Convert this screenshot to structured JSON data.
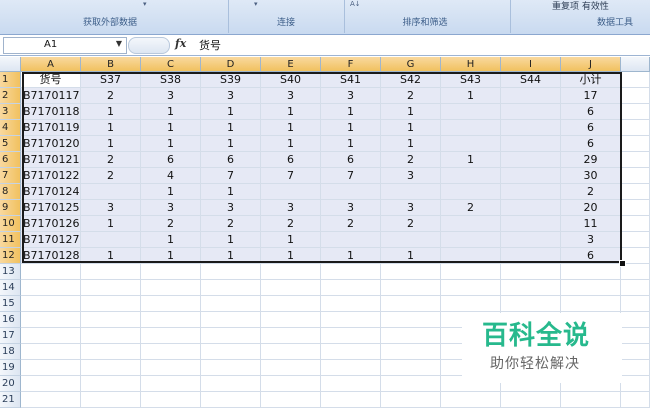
{
  "ribbon": {
    "groups": [
      {
        "label": "获取外部数据"
      },
      {
        "label": "连接"
      },
      {
        "label": "排序和筛选"
      },
      {
        "label": "数据工具"
      }
    ],
    "upper_text": "重复项 有效性"
  },
  "formula_bar": {
    "name_box": "A1",
    "fx_label": "fx",
    "content": "货号"
  },
  "columns": [
    "A",
    "B",
    "C",
    "D",
    "E",
    "F",
    "G",
    "H",
    "I",
    "J"
  ],
  "row_numbers": [
    "1",
    "2",
    "3",
    "4",
    "5",
    "6",
    "7",
    "8",
    "9",
    "10",
    "11",
    "12",
    "13",
    "14",
    "15",
    "16",
    "17",
    "18",
    "19",
    "20",
    "21"
  ],
  "table": {
    "header": [
      "货号",
      "S37",
      "S38",
      "S39",
      "S40",
      "S41",
      "S42",
      "S43",
      "S44",
      "小计"
    ],
    "rows": [
      [
        "B7170117",
        "2",
        "3",
        "3",
        "3",
        "3",
        "2",
        "1",
        "",
        "17"
      ],
      [
        "B7170118",
        "1",
        "1",
        "1",
        "1",
        "1",
        "1",
        "",
        "",
        "6"
      ],
      [
        "B7170119",
        "1",
        "1",
        "1",
        "1",
        "1",
        "1",
        "",
        "",
        "6"
      ],
      [
        "B7170120",
        "1",
        "1",
        "1",
        "1",
        "1",
        "1",
        "",
        "",
        "6"
      ],
      [
        "B7170121",
        "2",
        "6",
        "6",
        "6",
        "6",
        "2",
        "1",
        "",
        "29"
      ],
      [
        "B7170122",
        "2",
        "4",
        "7",
        "7",
        "7",
        "3",
        "",
        "",
        "30"
      ],
      [
        "B7170124",
        "",
        "1",
        "1",
        "",
        "",
        "",
        "",
        "",
        "2"
      ],
      [
        "B7170125",
        "3",
        "3",
        "3",
        "3",
        "3",
        "3",
        "2",
        "",
        "20"
      ],
      [
        "B7170126",
        "1",
        "2",
        "2",
        "2",
        "2",
        "2",
        "",
        "",
        "11"
      ],
      [
        "B7170127",
        "",
        "1",
        "1",
        "1",
        "",
        "",
        "",
        "",
        "3"
      ],
      [
        "B7170128",
        "1",
        "1",
        "1",
        "1",
        "1",
        "1",
        "",
        "",
        "6"
      ]
    ]
  },
  "watermark": {
    "title": "百科全说",
    "subtitle": "助你轻松解决"
  },
  "colors": {
    "selection_header": "#f1c15f",
    "highlight_cell": "#e6e9f5",
    "watermark_green": "#27b98d"
  }
}
